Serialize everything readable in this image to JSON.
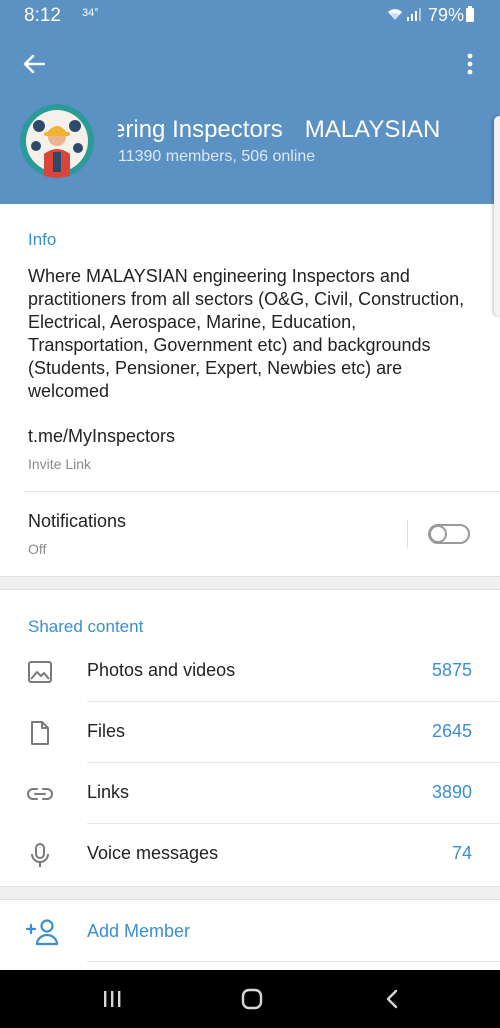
{
  "status_bar": {
    "time": "8:12",
    "temperature": "34°",
    "battery_percent": "79%",
    "icons": [
      "wifi-icon",
      "signal-icon",
      "battery-icon"
    ]
  },
  "header": {
    "title_part1": "ineering Inspectors",
    "title_part2": "MALAYSIAN",
    "subtitle": "11390 members, 506 online",
    "icons": [
      "back-arrow-icon",
      "more-vert-icon"
    ]
  },
  "info": {
    "section_title": "Info",
    "description": "Where MALAYSIAN engineering Inspectors and practitioners from all sectors (O&G, Civil, Construction, Electrical, Aerospace, Marine, Education, Transportation, Government etc) and backgrounds (Students, Pensioner, Expert, Newbies etc) are welcomed",
    "invite_link": "t.me/MyInspectors",
    "invite_link_caption": "Invite Link"
  },
  "notifications": {
    "label": "Notifications",
    "state": "Off",
    "enabled": false
  },
  "shared_content": {
    "section_title": "Shared content",
    "items": [
      {
        "label": "Photos and videos",
        "count": "5875",
        "icon": "image-icon"
      },
      {
        "label": "Files",
        "count": "2645",
        "icon": "file-icon"
      },
      {
        "label": "Links",
        "count": "3890",
        "icon": "link-icon"
      },
      {
        "label": "Voice messages",
        "count": "74",
        "icon": "mic-icon"
      }
    ]
  },
  "actions": {
    "add_member": "Add Member",
    "add_member_icon": "add-person-icon"
  },
  "colors": {
    "header_bg": "#5b91c3",
    "accent": "#3a8fd1",
    "nav_bg": "#000000"
  },
  "nav_bar": {
    "icons": [
      "recent-apps-icon",
      "home-icon",
      "back-icon"
    ]
  }
}
